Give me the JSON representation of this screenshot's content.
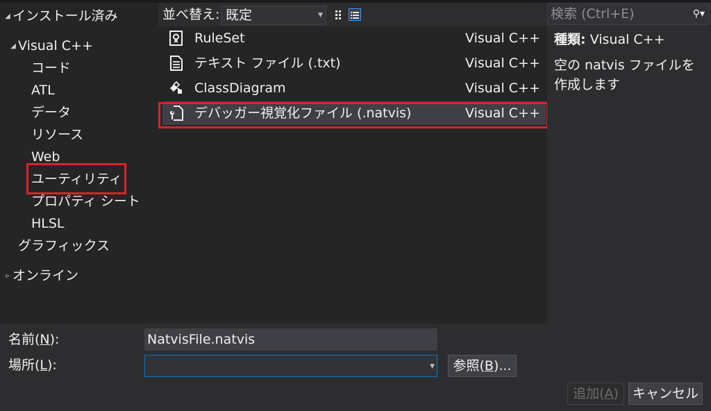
{
  "tree": {
    "installed": "インストール済み",
    "visual_cpp": "Visual C++",
    "children": [
      "コード",
      "ATL",
      "データ",
      "リソース",
      "Web",
      "ユーティリティ",
      "プロパティ シート",
      "HLSL"
    ],
    "graphics": "グラフィックス",
    "online": "オンライン"
  },
  "sort": {
    "label": "並べ替え:",
    "value": "既定"
  },
  "templates": [
    {
      "name": "RuleSet",
      "lang": "Visual C++",
      "icon": "ruleset-icon"
    },
    {
      "name": "テキスト ファイル (.txt)",
      "lang": "Visual C++",
      "icon": "text-file-icon"
    },
    {
      "name": "ClassDiagram",
      "lang": "Visual C++",
      "icon": "class-diagram-icon"
    },
    {
      "name": "デバッガー視覚化ファイル (.natvis)",
      "lang": "Visual C++",
      "icon": "natvis-file-icon",
      "selected": true
    }
  ],
  "search": {
    "placeholder": "検索 (Ctrl+E)"
  },
  "details": {
    "type_label": "種類:",
    "type_value": "Visual C++",
    "description": "空の natvis ファイルを作成します"
  },
  "form": {
    "name_label": "名前(",
    "name_key": "N",
    "name_suffix": "):",
    "name_value": "NatvisFile.natvis",
    "location_label": "場所(",
    "location_key": "L",
    "location_suffix": "):",
    "location_value": "",
    "browse_prefix": "参照(",
    "browse_key": "B",
    "browse_suffix": ")...",
    "add_prefix": "追加(",
    "add_key": "A",
    "add_suffix": ")",
    "cancel": "キャンセル"
  },
  "colors": {
    "highlight": "#e0202a",
    "background": "#2d2d30",
    "panel": "#252526",
    "text": "#f1f1f1",
    "accent_border": "#007acc"
  }
}
